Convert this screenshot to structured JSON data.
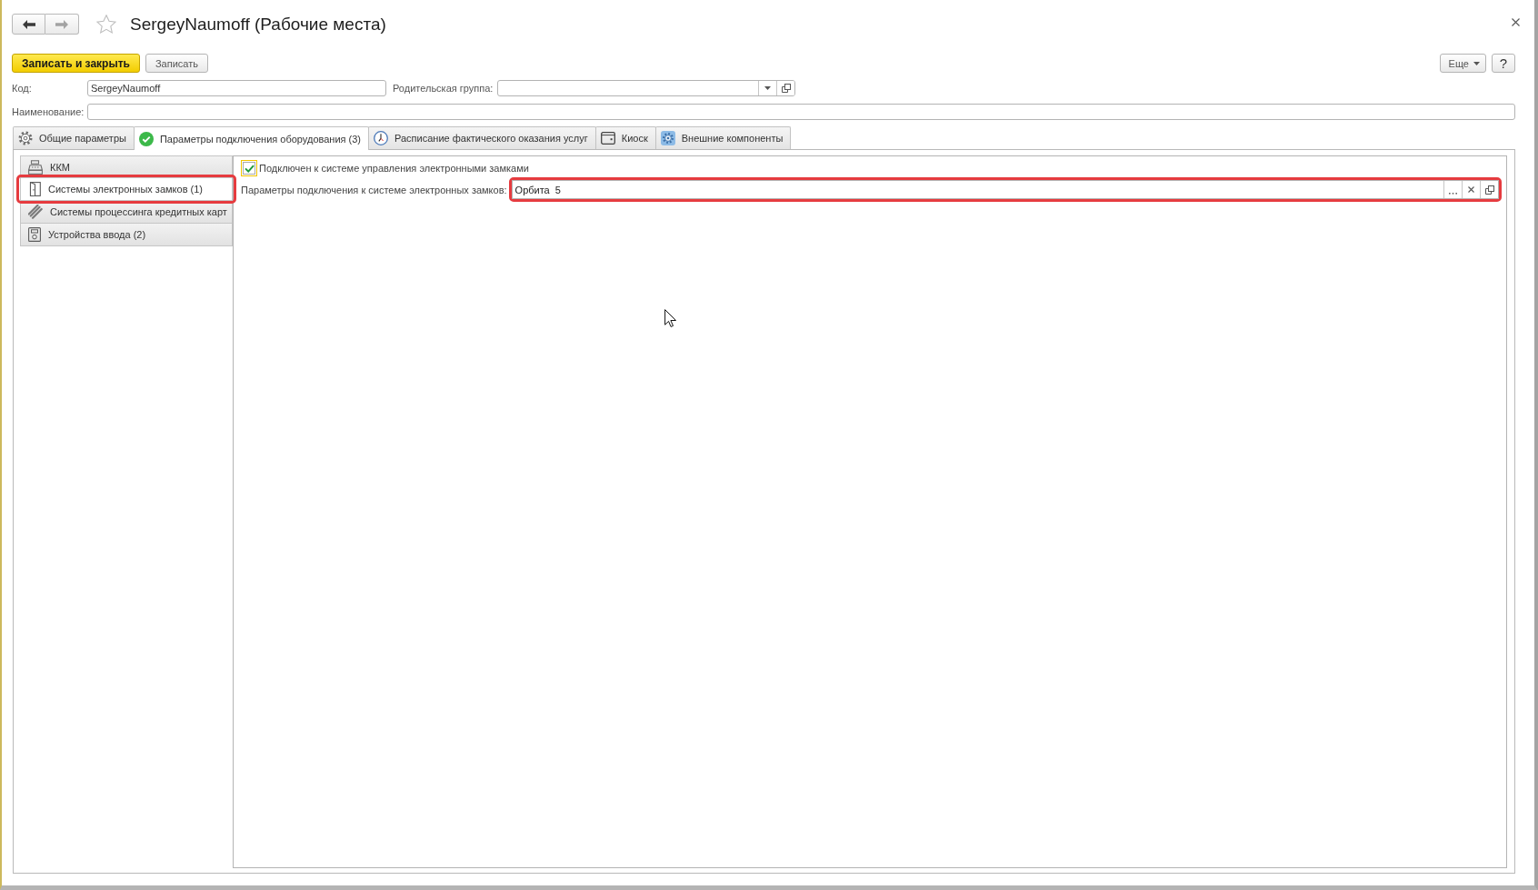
{
  "window": {
    "title": "SergeyNaumoff (Рабочие места)",
    "favorite": false,
    "navigation": {
      "back_disabled": false,
      "forward_disabled": true
    }
  },
  "toolbar": {
    "buttons": [
      {
        "label": "Записать и закрыть",
        "kind": "primary"
      },
      {
        "label": "Записать",
        "kind": "default"
      }
    ],
    "more": "Еще",
    "help": "?"
  },
  "fields": {
    "code": {
      "label": "Код:",
      "value": "SergeyNaumoff"
    },
    "parent_group": {
      "label": "Родительская группа:"
    },
    "name": {
      "label": "Наименование:"
    }
  },
  "tabs": [
    {
      "label": "Общие параметры",
      "selected": false
    },
    {
      "label": "Параметры подключения оборудования (3)",
      "selected": true
    },
    {
      "label": "Расписание фактического оказания услуг",
      "selected": false
    },
    {
      "label": "Киоск",
      "selected": false
    },
    {
      "label": "Внешние компоненты",
      "selected": false
    }
  ],
  "equipment_types": [
    {
      "label": "ККМ",
      "selected": false,
      "highlighted": false
    },
    {
      "label": "Системы электронных замков (1)",
      "selected": true,
      "highlighted": true
    },
    {
      "label": "Системы процессинга кредитных карт",
      "selected": false,
      "highlighted": false
    },
    {
      "label": "Устройства ввода (2)",
      "selected": false,
      "highlighted": false
    }
  ],
  "lock_system": {
    "connected": {
      "label": "Подключен к системе управления электронными замками",
      "checked": true,
      "focused": true
    },
    "connection": {
      "label": "Параметры подключения к системе электронных замков:",
      "value": "Орбита  5",
      "highlighted": true
    }
  }
}
